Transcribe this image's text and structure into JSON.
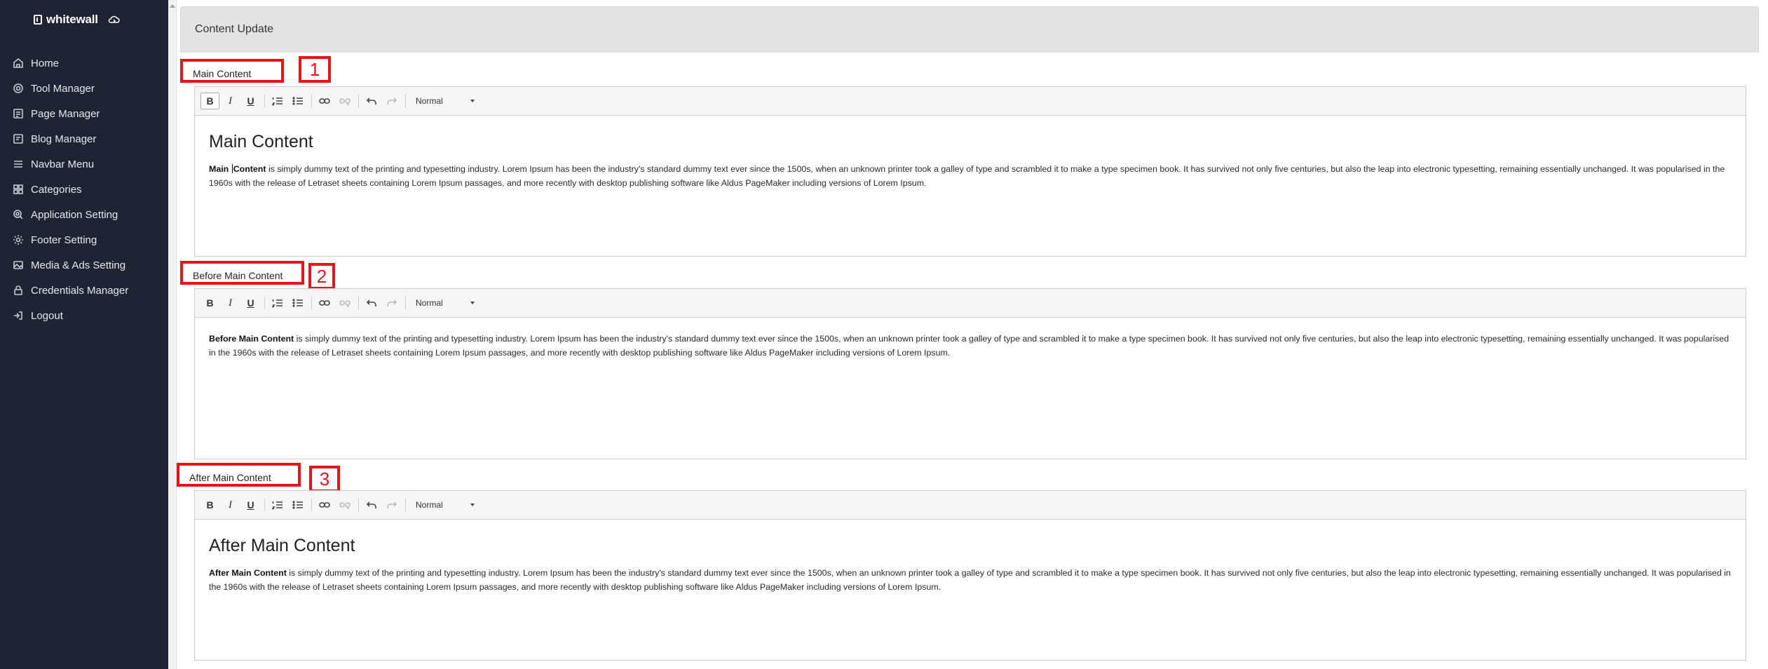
{
  "app": {
    "logo_text": "whitewall"
  },
  "sidebar": {
    "items": [
      {
        "label": "Home",
        "icon": "home-icon"
      },
      {
        "label": "Tool Manager",
        "icon": "gear-icon"
      },
      {
        "label": "Page Manager",
        "icon": "page-icon"
      },
      {
        "label": "Blog Manager",
        "icon": "blog-icon"
      },
      {
        "label": "Navbar Menu",
        "icon": "menu-icon"
      },
      {
        "label": "Categories",
        "icon": "categories-icon"
      },
      {
        "label": "Application Setting",
        "icon": "settings-icon"
      },
      {
        "label": "Footer Setting",
        "icon": "footer-icon"
      },
      {
        "label": "Media & Ads Setting",
        "icon": "media-icon"
      },
      {
        "label": "Credentials Manager",
        "icon": "lock-icon"
      },
      {
        "label": "Logout",
        "icon": "logout-icon"
      }
    ]
  },
  "page": {
    "title": "Content Update"
  },
  "sections": [
    {
      "label": "Main Content",
      "annotation": "1",
      "format_value": "Normal",
      "heading": "Main Content",
      "bold_lead_a": "Main",
      "bold_lead_b": "Content",
      "body": " is simply dummy text of the printing and typesetting industry. Lorem Ipsum has been the industry's standard dummy text ever since the 1500s, when an unknown printer took a galley of type and scrambled it to make a type specimen book. It has survived not only five centuries, but also the leap into electronic typesetting, remaining essentially unchanged. It was popularised in the 1960s with the release of Letraset sheets containing Lorem Ipsum passages, and more recently with desktop publishing software like Aldus PageMaker including versions of Lorem Ipsum."
    },
    {
      "label": "Before Main Content",
      "annotation": "2",
      "format_value": "Normal",
      "bold_lead": "Before Main Content",
      "body": " is simply dummy text of the printing and typesetting industry. Lorem Ipsum has been the industry's standard dummy text ever since the 1500s, when an unknown printer took a galley of type and scrambled it to make a type specimen book. It has survived not only five centuries, but also the leap into electronic typesetting, remaining essentially unchanged. It was popularised in the 1960s with the release of Letraset sheets containing Lorem Ipsum passages, and more recently with desktop publishing software like Aldus PageMaker including versions of Lorem Ipsum."
    },
    {
      "label": "After Main Content",
      "annotation": "3",
      "format_value": "Normal",
      "heading": "After Main Content",
      "bold_lead": "After Main Content",
      "body": " is simply dummy text of the printing and typesetting industry. Lorem Ipsum has been the industry's standard dummy text ever since the 1500s, when an unknown printer took a galley of type and scrambled it to make a type specimen book. It has survived not only five centuries, but also the leap into electronic typesetting, remaining essentially unchanged. It was popularised in the 1960s with the release of Letraset sheets containing Lorem Ipsum passages, and more recently with desktop publishing software like Aldus PageMaker including versions of Lorem Ipsum."
    }
  ],
  "toolbar": {
    "bold_label": "B",
    "italic_label": "I",
    "underline_label": "U"
  },
  "colors": {
    "sidebar_bg": "#1e2434",
    "annotation_red": "#e8141c"
  }
}
